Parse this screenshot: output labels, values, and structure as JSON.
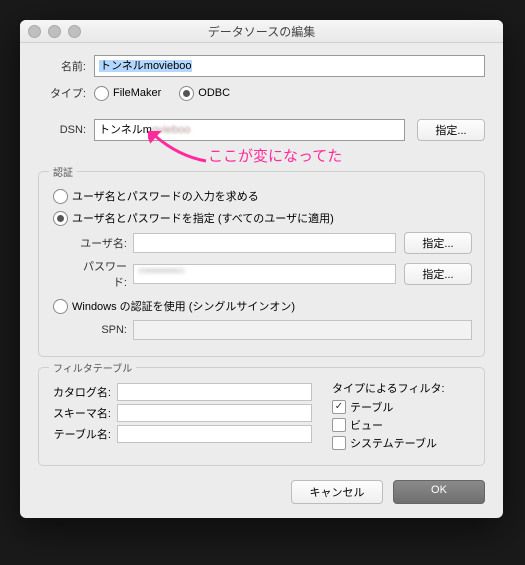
{
  "window": {
    "title": "データソースの編集"
  },
  "annotation": {
    "text": "ここが変になってた"
  },
  "fields": {
    "name_label": "名前:",
    "name_value": "トンネルmovieboo",
    "type_label": "タイプ:",
    "dsn_label": "DSN:",
    "dsn_value_prefix": "トンネルm",
    "dsn_value_blur": "ovieboo",
    "specify": "指定..."
  },
  "type_options": {
    "filemaker": "FileMaker",
    "odbc": "ODBC"
  },
  "auth": {
    "group_title": "認証",
    "prompt": "ユーザ名とパスワードの入力を求める",
    "specify": "ユーザ名とパスワードを指定 (すべてのユーザに適用)",
    "username_label": "ユーザ名:",
    "username_value": "",
    "password_label": "パスワード:",
    "password_value": "<••••••••••>",
    "windows": "Windows の認証を使用 (シングルサインオン)",
    "spn_label": "SPN:"
  },
  "filter": {
    "group_title": "フィルタテーブル",
    "catalog_label": "カタログ名:",
    "schema_label": "スキーマ名:",
    "table_label": "テーブル名:",
    "type_title": "タイプによるフィルタ:",
    "opt_table": "テーブル",
    "opt_view": "ビュー",
    "opt_system": "システムテーブル"
  },
  "footer": {
    "cancel": "キャンセル",
    "ok": "OK"
  }
}
